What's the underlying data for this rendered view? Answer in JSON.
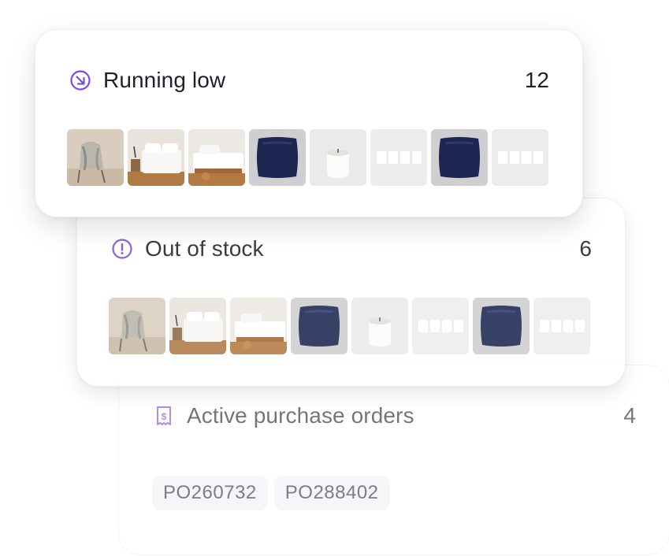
{
  "cards": {
    "running_low": {
      "title": "Running low",
      "count": "12",
      "icon": "arrow-down-right-circle-icon",
      "products": [
        "throw-blanket-chair",
        "white-bedding-nightstand",
        "white-bed-wooden-frame",
        "navy-velvet-pillow",
        "white-candle",
        "candle-set",
        "navy-velvet-pillow",
        "candle-set"
      ]
    },
    "out_of_stock": {
      "title": "Out of stock",
      "count": "6",
      "icon": "exclamation-circle-icon",
      "products": [
        "throw-blanket-chair",
        "white-bedding-nightstand",
        "white-bed-wooden-frame",
        "navy-velvet-pillow",
        "white-candle",
        "candle-set",
        "navy-velvet-pillow",
        "candle-set"
      ]
    },
    "active_purchase_orders": {
      "title": "Active purchase orders",
      "count": "4",
      "icon": "receipt-dollar-icon",
      "orders": [
        "PO260732",
        "PO288402"
      ]
    }
  },
  "colors": {
    "accent": "#7c4ddb",
    "text": "#1f2128",
    "chip_bg": "#eef1f5"
  }
}
